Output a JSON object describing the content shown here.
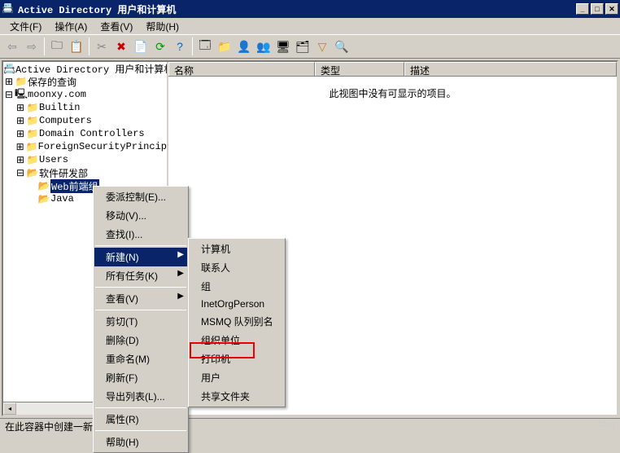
{
  "title": "Active Directory 用户和计算机",
  "menubar": [
    "文件(F)",
    "操作(A)",
    "查看(V)",
    "帮助(H)"
  ],
  "tree": {
    "root": "Active Directory 用户和计算机",
    "saved": "保存的查询",
    "domain": "moonxy.com",
    "nodes": [
      "Builtin",
      "Computers",
      "Domain Controllers",
      "ForeignSecurityPrincip",
      "Users",
      "软件研发部"
    ],
    "sub1": "Web前端组",
    "sub2": "Java"
  },
  "list": {
    "cols": [
      "名称",
      "类型",
      "描述"
    ],
    "empty": "此视图中没有可显示的项目。"
  },
  "context": {
    "items1": [
      "委派控制(E)...",
      "移动(V)...",
      "查找(I)..."
    ],
    "new": "新建(N)",
    "tasks": "所有任务(K)",
    "view": "查看(V)",
    "items2": [
      "剪切(T)",
      "删除(D)",
      "重命名(M)",
      "刷新(F)",
      "导出列表(L)..."
    ],
    "props": "属性(R)",
    "help": "帮助(H)"
  },
  "submenu": [
    "计算机",
    "联系人",
    "组",
    "InetOrgPerson",
    "MSMQ 队列别名",
    "组织单位",
    "打印机",
    "用户",
    "共享文件夹"
  ],
  "status": "在此容器中创建一新的项目。",
  "watermark": "blog"
}
